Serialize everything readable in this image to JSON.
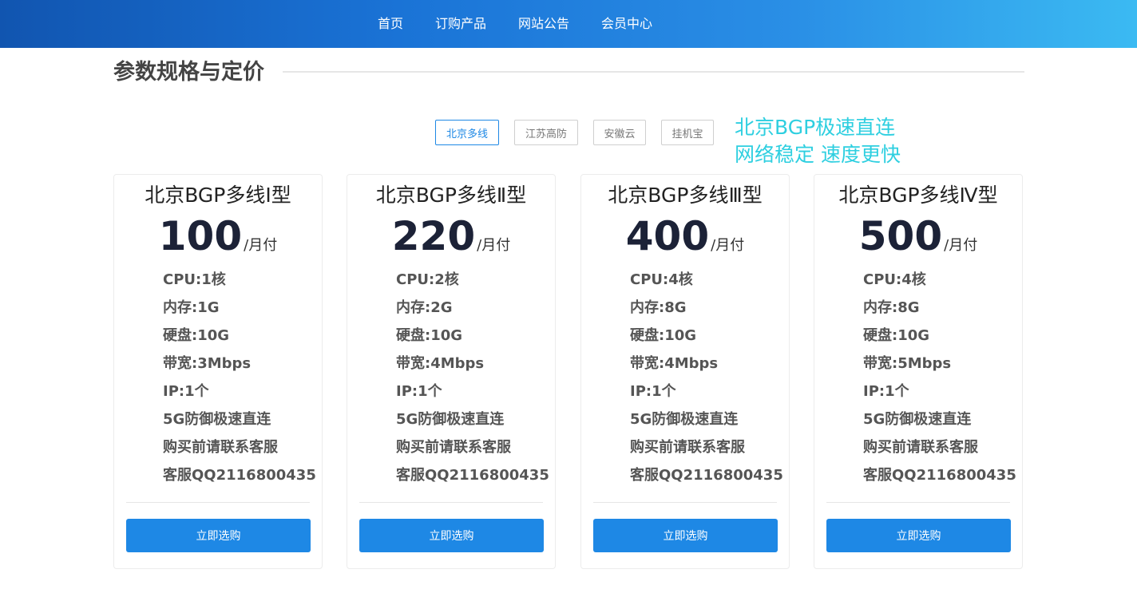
{
  "nav": {
    "items": [
      {
        "label": "首页"
      },
      {
        "label": "订购产品"
      },
      {
        "label": "网站公告"
      },
      {
        "label": "会员中心"
      }
    ]
  },
  "section": {
    "title": "参数规格与定价"
  },
  "tabs": [
    {
      "label": "北京多线",
      "active": true
    },
    {
      "label": "江苏高防",
      "active": false
    },
    {
      "label": "安徽云",
      "active": false
    },
    {
      "label": "挂机宝",
      "active": false
    }
  ],
  "promo": {
    "line1": "北京BGP极速直连",
    "line2": "网络稳定 速度更快"
  },
  "colors": {
    "accent": "#1e88e5",
    "promo": "#2ecfe0",
    "price": "#1c2237"
  },
  "plans": [
    {
      "name": "北京BGP多线Ⅰ型",
      "price": "100",
      "unit": "/月付",
      "specs": [
        "CPU:1核",
        "内存:1G",
        "硬盘:10G",
        "带宽:3Mbps",
        "IP:1个",
        "5G防御极速直连",
        "购买前请联系客服",
        "客服QQ2116800435"
      ],
      "button": "立即选购"
    },
    {
      "name": "北京BGP多线Ⅱ型",
      "price": "220",
      "unit": "/月付",
      "specs": [
        "CPU:2核",
        "内存:2G",
        "硬盘:10G",
        "带宽:4Mbps",
        "IP:1个",
        "5G防御极速直连",
        "购买前请联系客服",
        "客服QQ2116800435"
      ],
      "button": "立即选购"
    },
    {
      "name": "北京BGP多线Ⅲ型",
      "price": "400",
      "unit": "/月付",
      "specs": [
        "CPU:4核",
        "内存:8G",
        "硬盘:10G",
        "带宽:4Mbps",
        "IP:1个",
        "5G防御极速直连",
        "购买前请联系客服",
        "客服QQ2116800435"
      ],
      "button": "立即选购"
    },
    {
      "name": "北京BGP多线Ⅳ型",
      "price": "500",
      "unit": "/月付",
      "specs": [
        "CPU:4核",
        "内存:8G",
        "硬盘:10G",
        "带宽:5Mbps",
        "IP:1个",
        "5G防御极速直连",
        "购买前请联系客服",
        "客服QQ2116800435"
      ],
      "button": "立即选购"
    }
  ]
}
